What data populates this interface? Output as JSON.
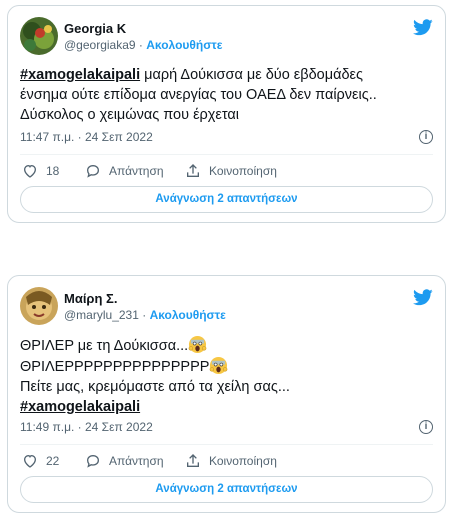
{
  "tweets": [
    {
      "name": "Georgia K",
      "handle": "@georgiaka9",
      "separator": "·",
      "follow": "Ακολουθήστε",
      "hashtag": "#xamogelakaipali",
      "line1_rest": " μαρή Δούκισσα με δύο εβδομάδες",
      "line2": "ένσημα ούτε επίδομα ανεργίας του ΟΑΕΔ δεν παίρνεις..",
      "line3": "Δύσκολος ο χειμώνας που έρχεται",
      "timestamp": "11:47 π.μ. · 24 Σεπ 2022",
      "likes": "18",
      "reply_label": "Απάντηση",
      "share_label": "Κοινοποίηση",
      "read_replies": "Ανάγνωση 2 απαντήσεων"
    },
    {
      "name": "Μαίρη Σ.",
      "handle": "@marylu_231",
      "separator": "·",
      "follow": "Ακολουθήστε",
      "line1": "ΘΡΙΛΕΡ με τη Δούκισσα...",
      "line2": "ΘΡΙΛΕΡΡΡΡΡΡΡΡΡΡΡΡΡΡΡ",
      "line3": "Πείτε μας, κρεμόμαστε από τα χείλη σας...",
      "hashtag": "#xamogelakaipali",
      "timestamp": "11:49 π.μ. · 24 Σεπ 2022",
      "likes": "22",
      "reply_label": "Απάντηση",
      "share_label": "Κοινοποίηση",
      "read_replies": "Ανάγνωση 2 απαντήσεων"
    }
  ],
  "icons": {
    "twitter": "twitter-bird-icon",
    "like": "heart-icon",
    "reply": "speech-bubble-icon",
    "share": "share-upload-icon",
    "info": "info-icon",
    "emoji": "screaming-face-emoji"
  },
  "colors": {
    "accent": "#1d9bf0",
    "text": "#0f1419",
    "muted": "#536471",
    "border": "#cfd9de"
  }
}
